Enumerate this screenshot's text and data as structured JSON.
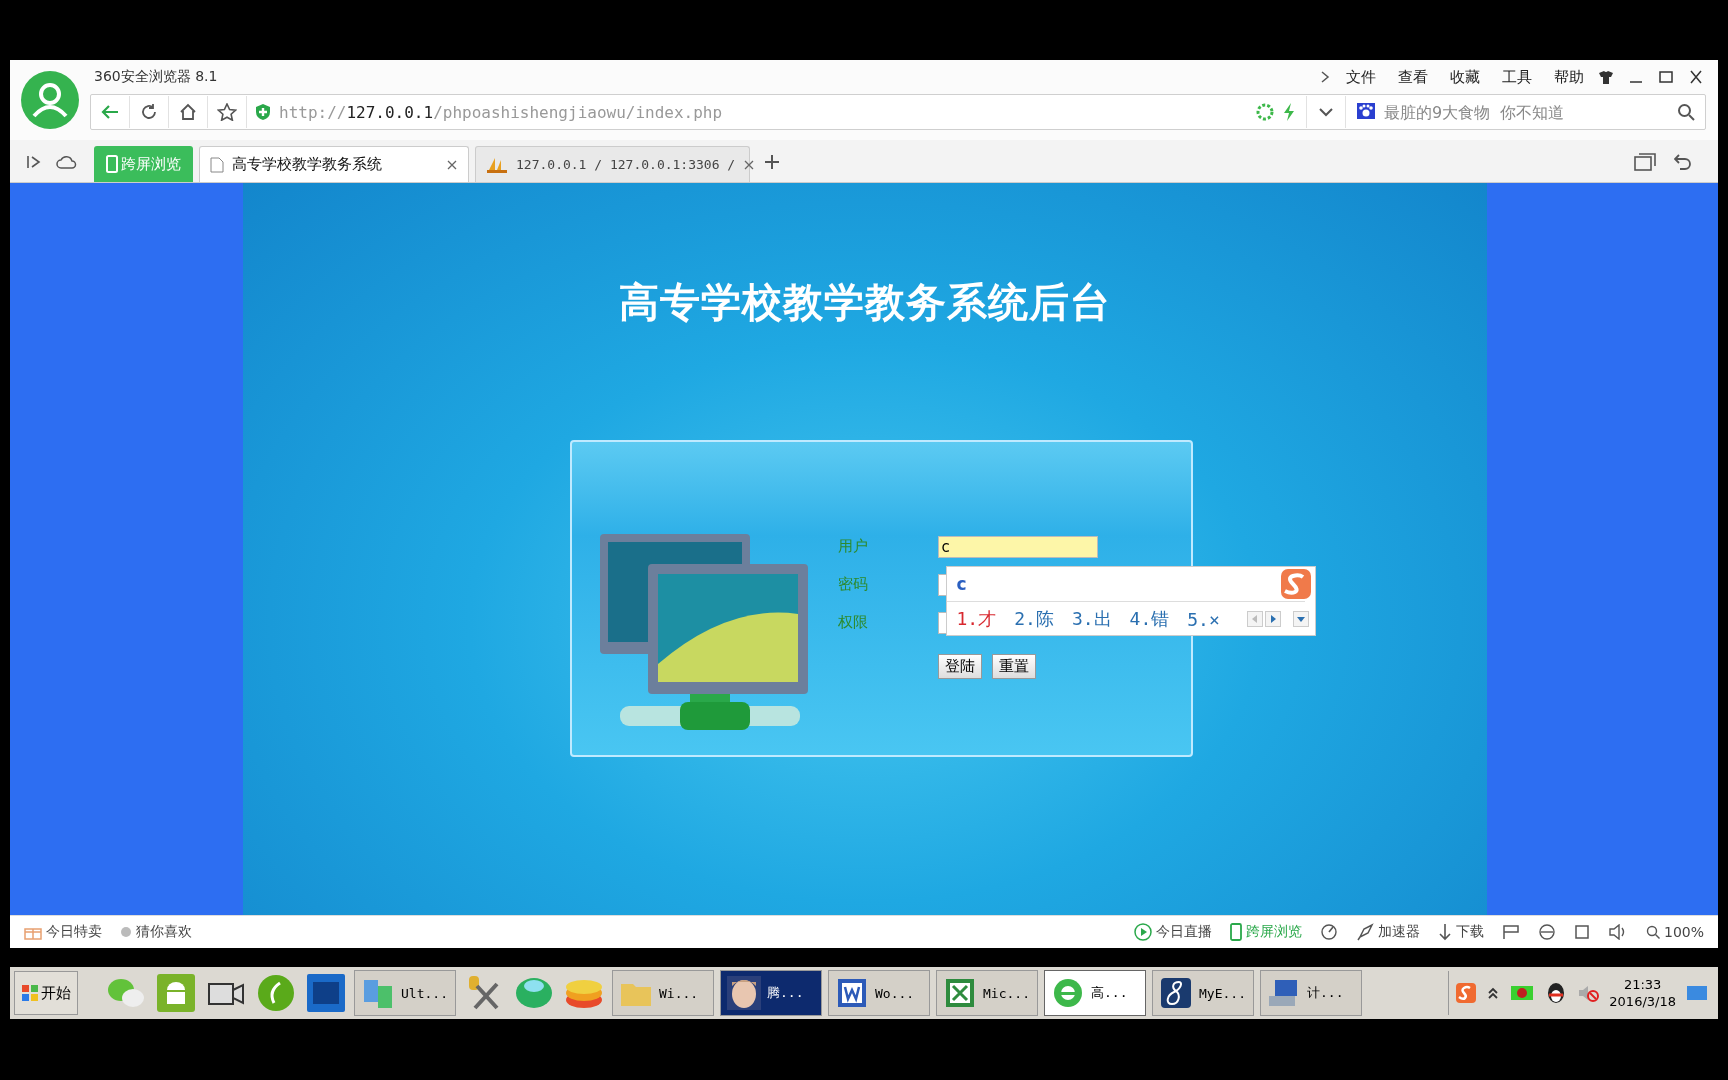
{
  "browser": {
    "title": "360安全浏览器 8.1",
    "menu": [
      "文件",
      "查看",
      "收藏",
      "工具",
      "帮助"
    ],
    "address": {
      "scheme": "http://",
      "host": "127.0.0.1",
      "path": "/phpoashishengjiaowu/index.php"
    },
    "search": {
      "placeholder": "最脏的9大食物  你不知道"
    },
    "cross_screen_button": "跨屏浏览",
    "tabs": [
      {
        "label": "高专学校教学教务系统",
        "selected": true
      },
      {
        "label": "127.0.0.1 / 127.0.0.1:3306 /",
        "selected": false
      }
    ]
  },
  "page": {
    "title": "高专学校教学教务系统后台",
    "fields": [
      {
        "label": "用户",
        "value": "c"
      },
      {
        "label": "密码"
      },
      {
        "label": "权限"
      }
    ],
    "buttons": [
      "登陆",
      "重置"
    ]
  },
  "ime": {
    "input": "c",
    "candidates": [
      {
        "label": "1.才",
        "selected": true
      },
      {
        "label": "2.陈",
        "selected": false
      },
      {
        "label": "3.出",
        "selected": false
      },
      {
        "label": "4.错",
        "selected": false
      },
      {
        "label": "5.×",
        "selected": false
      }
    ]
  },
  "status_bar": {
    "left": [
      "今日特卖",
      "猜你喜欢"
    ],
    "live": "今日直播",
    "cross_screen": "跨屏浏览",
    "accelerator": "加速器",
    "download": "下载",
    "zoom": "100%"
  },
  "taskbar": {
    "start": "开始",
    "tasks": [
      {
        "label": "Ult...",
        "kind": "app",
        "selected": false
      },
      {
        "label": "Wi...",
        "kind": "folder",
        "selected": false
      },
      {
        "label": "腾...",
        "selected": false
      },
      {
        "label": "Wo...",
        "kind": "word",
        "selected": false
      },
      {
        "label": "Mic...",
        "kind": "excel",
        "selected": false
      },
      {
        "label": "高...",
        "kind": "browser",
        "selected": true
      },
      {
        "label": "MyE...",
        "kind": "eclipse",
        "selected": false
      },
      {
        "label": "计...",
        "kind": "computer",
        "selected": false
      }
    ],
    "time": "21:33",
    "date": "2016/3/18"
  }
}
